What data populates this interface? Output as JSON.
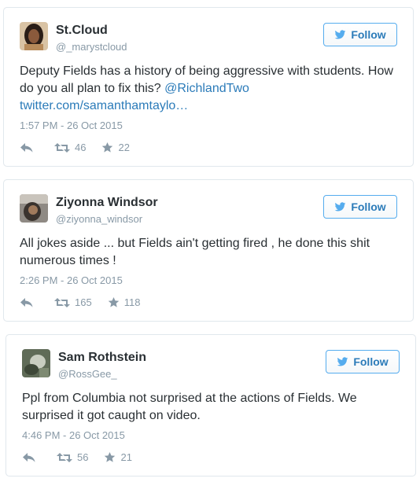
{
  "colors": {
    "link": "#2b7bb9",
    "follow_border": "#55acee",
    "muted": "#8899a6",
    "text": "#292f33"
  },
  "icons": {
    "follow": "twitter-bird-icon",
    "reply": "reply-icon",
    "retweet": "retweet-icon",
    "favorite": "star-icon"
  },
  "tweets": [
    {
      "name": "St.Cloud",
      "handle": "@_marystcloud",
      "follow_label": "Follow",
      "text_1": "Deputy Fields has a history of being aggressive with students. How do you all plan to fix this? ",
      "mention": "@RichlandTwo",
      "link": "twitter.com/samanthamtaylo…",
      "time": "1:57 PM - 26 Oct 2015",
      "retweets": "46",
      "favorites": "22"
    },
    {
      "name": "Ziyonna Windsor",
      "handle": "@ziyonna_windsor",
      "follow_label": "Follow",
      "text": "All jokes aside ... but Fields ain't getting fired , he done this shit numerous times !",
      "time": "2:26 PM - 26 Oct 2015",
      "retweets": "165",
      "favorites": "118"
    },
    {
      "name": "Sam Rothstein",
      "handle": "@RossGee_",
      "follow_label": "Follow",
      "text": "Ppl from Columbia not surprised at the actions of Fields. We surprised it got caught on video.",
      "time": "4:46 PM - 26 Oct 2015",
      "retweets": "56",
      "favorites": "21"
    }
  ]
}
